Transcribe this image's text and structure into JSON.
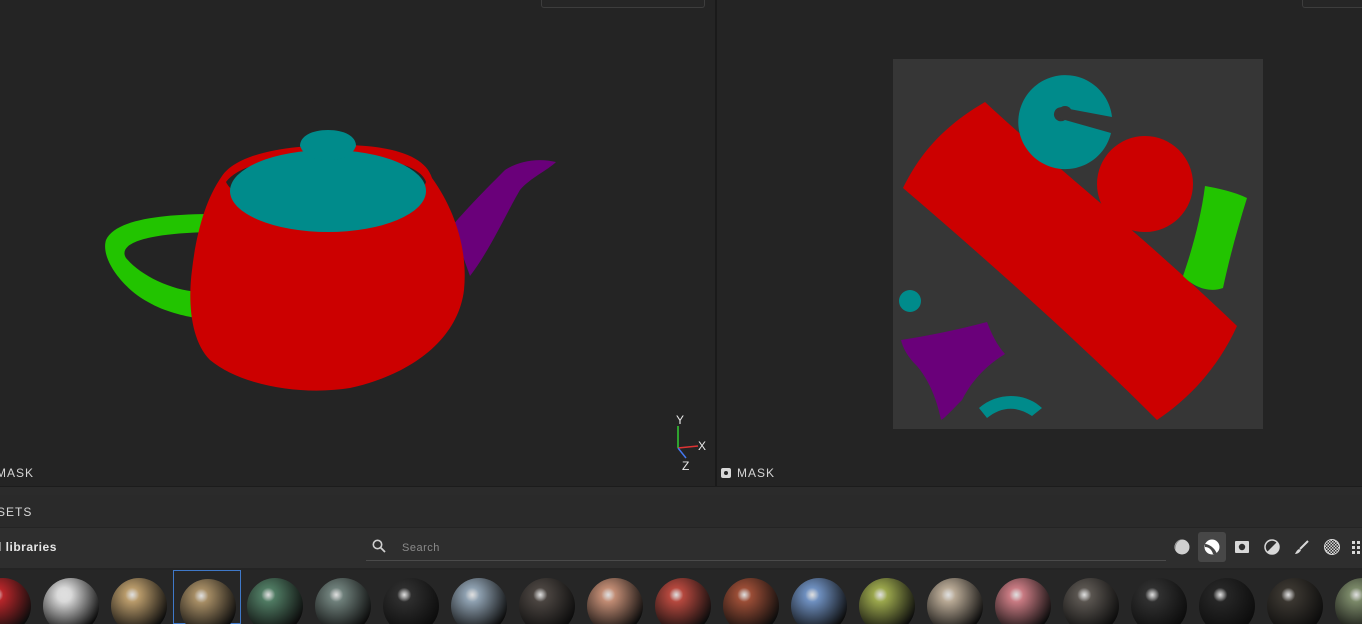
{
  "viewport3d": {
    "label": "MASK",
    "axes": {
      "y": "Y",
      "x": "X",
      "z": "Z"
    }
  },
  "viewport2d": {
    "label": "MASK"
  },
  "shelf": {
    "title": "ASSETS",
    "library_label": "All libraries",
    "search": {
      "placeholder": "Search",
      "value": ""
    },
    "filters": [
      {
        "icon": "material-sphere-icon",
        "active": false
      },
      {
        "icon": "smart-material-icon",
        "active": true
      },
      {
        "icon": "mask-filter-icon",
        "active": false
      },
      {
        "icon": "half-sphere-icon",
        "active": false
      },
      {
        "icon": "brush-icon",
        "active": false
      },
      {
        "icon": "checker-texture-icon",
        "active": false
      },
      {
        "icon": "grid-icon",
        "active": false
      }
    ],
    "materials": [
      {
        "color": "#b8262a",
        "selected": false
      },
      {
        "color": "#d9d9d9",
        "selected": false
      },
      {
        "color": "#b89a6a",
        "selected": false
      },
      {
        "color": "#a58c64",
        "selected": true
      },
      {
        "color": "#4f7a62",
        "selected": false
      },
      {
        "color": "#6e7f7a",
        "selected": false
      },
      {
        "color": "#2e2e2e",
        "selected": false
      },
      {
        "color": "#8ea0b0",
        "selected": false
      },
      {
        "color": "#4a4440",
        "selected": false
      },
      {
        "color": "#c08b73",
        "selected": false
      },
      {
        "color": "#b5483e",
        "selected": false
      },
      {
        "color": "#9a4d36",
        "selected": false
      },
      {
        "color": "#6e8fbf",
        "selected": false
      },
      {
        "color": "#9aa64c",
        "selected": false
      },
      {
        "color": "#b7a894",
        "selected": false
      },
      {
        "color": "#c87a82",
        "selected": false
      },
      {
        "color": "#5a5550",
        "selected": false
      },
      {
        "color": "#303030",
        "selected": false
      },
      {
        "color": "#262626",
        "selected": false
      },
      {
        "color": "#3a3630",
        "selected": false
      },
      {
        "color": "#7a8868",
        "selected": false
      }
    ]
  },
  "colors": {
    "red": "#cc0000",
    "teal": "#008b8b",
    "green": "#22c400",
    "purple": "#6a007a",
    "uv_bg": "#363636",
    "accent": "#3f78c8"
  }
}
